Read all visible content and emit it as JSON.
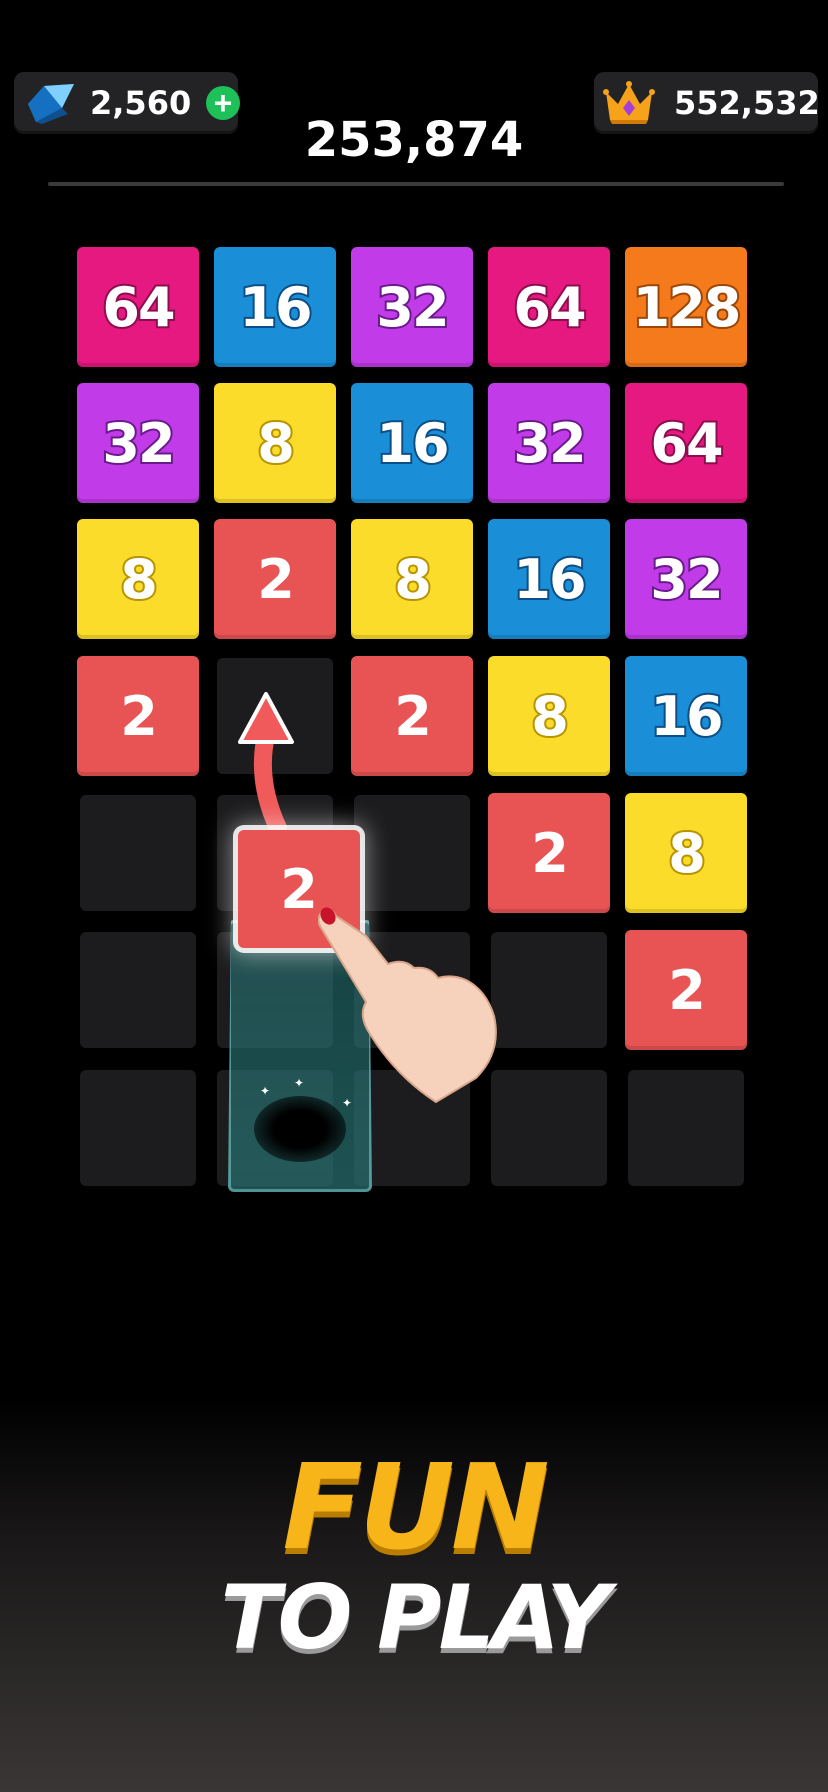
{
  "hud": {
    "gem_count": "2,560",
    "add_gems_label": "+",
    "score": "253,874",
    "best_score": "552,532",
    "gem_icon": "gem-icon",
    "crown_icon": "crown-icon"
  },
  "board": {
    "columns": 5,
    "rows": 7,
    "tiles": [
      [
        "64",
        "16",
        "32",
        "64",
        "128"
      ],
      [
        "32",
        "8",
        "16",
        "32",
        "64"
      ],
      [
        "8",
        "2",
        "8",
        "16",
        "32"
      ],
      [
        "2",
        "",
        "2",
        "8",
        "16"
      ],
      [
        "",
        "",
        "",
        "2",
        "8"
      ],
      [
        "",
        "",
        "",
        "",
        "2"
      ],
      [
        "",
        "",
        "",
        "",
        ""
      ]
    ]
  },
  "shooter": {
    "value": "2",
    "column": 2
  },
  "tagline": {
    "line1": "FUN",
    "line2": "TO PLAY"
  },
  "colors": {
    "t2": "#e85454",
    "t8": "#fbdc2b",
    "t16": "#1a8fd8",
    "t32": "#c23be8",
    "t64": "#e51980",
    "t128": "#f47a1c",
    "accent": "#f8b51a"
  }
}
